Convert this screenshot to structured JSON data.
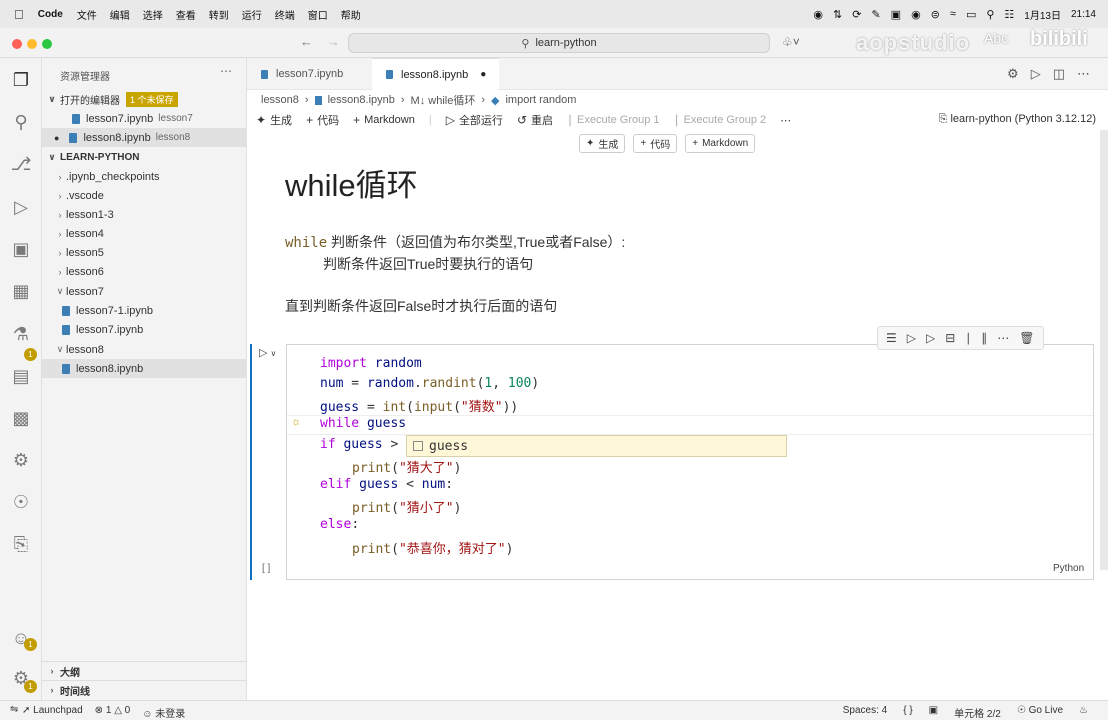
{
  "menubar": {
    "apple": "",
    "app": "Code",
    "items": [
      "文件",
      "编辑",
      "选择",
      "查看",
      "转到",
      "运行",
      "终端",
      "窗口",
      "帮助"
    ],
    "date": "1月13日",
    "time": "21:14"
  },
  "titlebar": {
    "search": "learn-python"
  },
  "watermark": {
    "text": "aopstudio",
    "abc": "Abc",
    "bili": "bilibili"
  },
  "sidebar": {
    "title": "资源管理器",
    "open_editors": "打开的编辑器",
    "unsaved": "1 个未保存",
    "open_files": [
      {
        "name": "lesson7.ipynb",
        "folder": "lesson7"
      },
      {
        "name": "lesson8.ipynb",
        "folder": "lesson8"
      }
    ],
    "project": "LEARN-PYTHON",
    "tree": [
      {
        "label": ".ipynb_checkpoints"
      },
      {
        "label": ".vscode"
      },
      {
        "label": "lesson1-3"
      },
      {
        "label": "lesson4"
      },
      {
        "label": "lesson5"
      },
      {
        "label": "lesson6"
      },
      {
        "label": "lesson7"
      },
      {
        "label": "lesson7-1.ipynb"
      },
      {
        "label": "lesson7.ipynb"
      },
      {
        "label": "lesson8"
      },
      {
        "label": "lesson8.ipynb"
      }
    ],
    "outline": "大纲",
    "timeline": "时间线"
  },
  "tabs": [
    {
      "label": "lesson7.ipynb"
    },
    {
      "label": "lesson8.ipynb"
    }
  ],
  "breadcrumb": [
    "lesson8",
    "lesson8.ipynb",
    "M↓ while循环",
    "import random"
  ],
  "toolbar": {
    "generate": "生成",
    "code": "代码",
    "markdown": "Markdown",
    "run_all": "全部运行",
    "restart": "重启",
    "group1": "Execute Group 1",
    "group2": "Execute Group 2",
    "kernel": "learn-python (Python 3.12.12)"
  },
  "addbar": {
    "generate": "生成",
    "code": "代码",
    "markdown": "Markdown"
  },
  "markdown": {
    "h1": "while循环",
    "kw": "while",
    "line1": " 判断条件（返回值为布尔类型,True或者False）:",
    "line2": "判断条件返回True时要执行的语句",
    "line3": "直到判断条件返回False时才执行后面的语句"
  },
  "code": {
    "l1a": "import",
    "l1b": " random",
    "l2a": "num",
    "l2b": " = ",
    "l2c": "random",
    "l2d": ".",
    "l2e": "randint",
    "l2f": "(",
    "l2g": "1",
    "l2h": ", ",
    "l2i": "100",
    "l2j": ")",
    "l3a": "guess",
    "l3b": " = ",
    "l3c": "int",
    "l3d": "(",
    "l3e": "input",
    "l3f": "(",
    "l3g": "\"猜数\"",
    "l3h": "))",
    "l4a": "while",
    "l4b": " guess",
    "l5a": "if",
    "l5b": " guess",
    "l5c": " >",
    "l6a": "print",
    "l6b": "(",
    "l6c": "\"猜大了\"",
    "l6d": ")",
    "l7a": "elif",
    "l7b": " guess",
    "l7c": " < ",
    "l7d": "num",
    "l7e": ":",
    "l8a": "print",
    "l8b": "(",
    "l8c": "\"猜小了\"",
    "l8d": ")",
    "l9a": "else",
    "l9b": ":",
    "l10a": "print",
    "l10b": "(",
    "l10c": "\"恭喜你，猜对了\"",
    "l10d": ")",
    "suggestion": "guess",
    "language": "Python",
    "cell_number": "[ ]"
  },
  "status": {
    "launchpad": "Launchpad",
    "errors": "1",
    "warnings": "0",
    "login": "未登录",
    "spaces": "Spaces: 4",
    "braces": "{ }",
    "cell": "单元格 2/2",
    "golive": "Go Live"
  },
  "badges": {
    "extensions": "1",
    "accounts": "1",
    "manage": "1"
  }
}
